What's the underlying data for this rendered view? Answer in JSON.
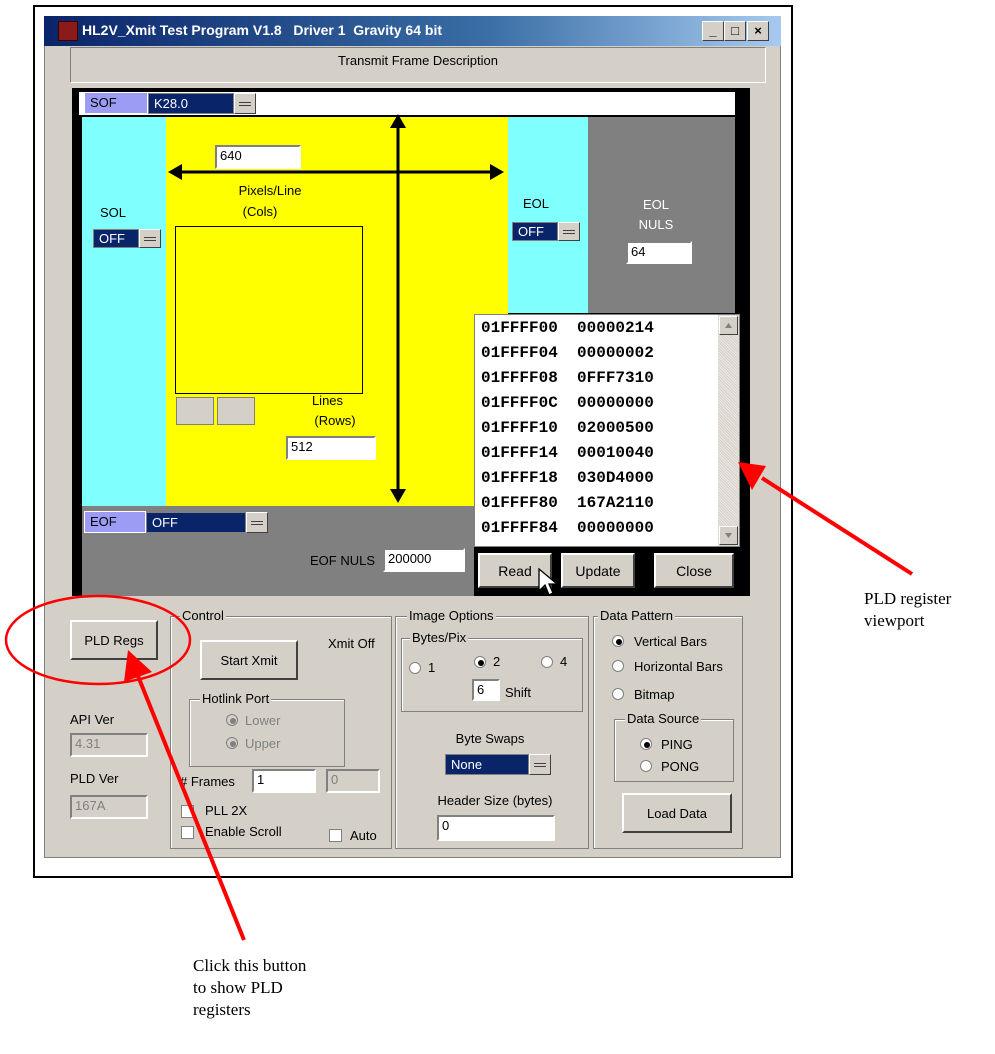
{
  "window": {
    "title": "HL2V_Xmit Test Program V1.8   Driver 1  Gravity 64 bit",
    "min": "_",
    "max": "□",
    "close": "×"
  },
  "header": {
    "label": "Transmit Frame Description"
  },
  "frame": {
    "sof_label": "SOF",
    "sof_value": "K28.0",
    "sol_label": "SOL",
    "sol_value": "OFF",
    "pixels_value": "640",
    "pixels_label": "Pixels/Line",
    "cols_label": "(Cols)",
    "lines_label": "Lines",
    "rows_label": "(Rows)",
    "lines_value": "512",
    "eol_label": "EOL",
    "eol_value": "OFF",
    "eol_nuls_label1": "EOL",
    "eol_nuls_label2": "NULS",
    "eol_nuls_value": "64",
    "eof_label": "EOF",
    "eof_value": "OFF",
    "eof_nuls_label": "EOF NULS",
    "eof_nuls_value": "200000"
  },
  "registers": [
    {
      "addr": "01FFFF00",
      "value": "00000214"
    },
    {
      "addr": "01FFFF04",
      "value": "00000002"
    },
    {
      "addr": "01FFFF08",
      "value": "0FFF7310"
    },
    {
      "addr": "01FFFF0C",
      "value": "00000000"
    },
    {
      "addr": "01FFFF10",
      "value": "02000500"
    },
    {
      "addr": "01FFFF14",
      "value": "00010040"
    },
    {
      "addr": "01FFFF18",
      "value": "030D4000"
    },
    {
      "addr": "01FFFF80",
      "value": "167A2110"
    },
    {
      "addr": "01FFFF84",
      "value": "00000000"
    }
  ],
  "reg_buttons": {
    "read": "Read",
    "update": "Update",
    "close": "Close"
  },
  "left": {
    "pld_regs": "PLD Regs",
    "api_ver_label": "API Ver",
    "api_ver": "4.31",
    "pld_ver_label": "PLD Ver",
    "pld_ver": "167A"
  },
  "control": {
    "label": "Control",
    "start_xmit": "Start Xmit",
    "xmit_status": "Xmit Off",
    "hotlink_label": "Hotlink Port",
    "lower": "Lower",
    "upper": "Upper",
    "frames_label": "# Frames",
    "frames_value": "1",
    "frames_count": "0",
    "pll_2x": "PLL 2X",
    "enable_scroll": "Enable Scroll",
    "auto": "Auto"
  },
  "image_options": {
    "label": "Image Options",
    "bytes_pix_label": "Bytes/Pix",
    "opt1": "1",
    "opt2": "2",
    "opt4": "4",
    "selected": "2",
    "shift_value": "6",
    "shift_label": "Shift",
    "byte_swaps_label": "Byte Swaps",
    "byte_swaps_value": "None",
    "header_size_label": "Header Size (bytes)",
    "header_size_value": "0"
  },
  "data_pattern": {
    "label": "Data Pattern",
    "vertical": "Vertical Bars",
    "horizontal": "Horizontal Bars",
    "bitmap": "Bitmap",
    "selected": "Vertical Bars",
    "source_label": "Data Source",
    "ping": "PING",
    "pong": "PONG",
    "source_selected": "PING",
    "load_data": "Load Data"
  },
  "annotations": {
    "viewport": [
      "PLD register",
      "viewport"
    ],
    "button": [
      "Click this button",
      "to show PLD",
      "registers"
    ]
  },
  "colors": {
    "arrow": "#ff0000",
    "title_start": "#0a246a",
    "cyan": "#80ffff",
    "yellow": "#ffff00"
  }
}
